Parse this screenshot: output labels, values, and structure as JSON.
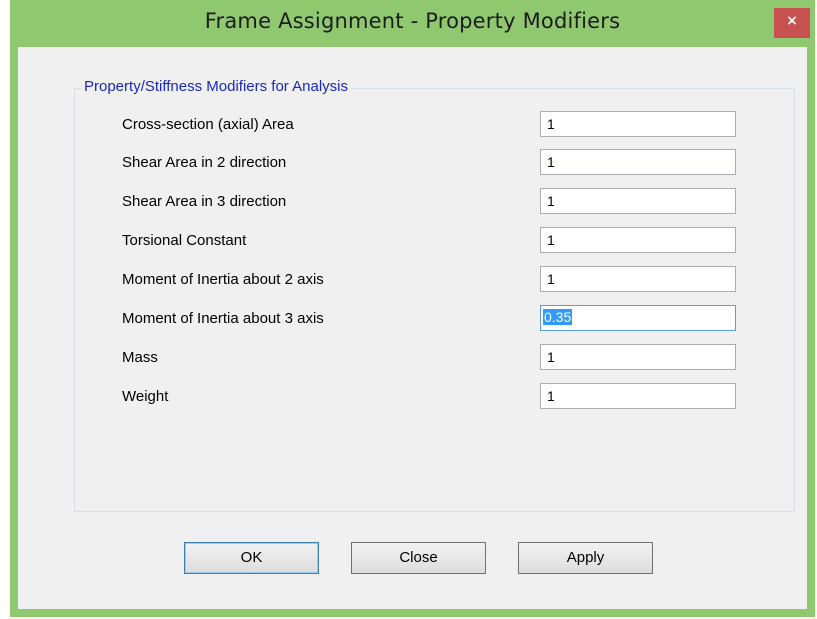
{
  "window": {
    "title": "Frame Assignment - Property Modifiers",
    "close_label": "×"
  },
  "group": {
    "legend": "Property/Stiffness Modifiers for Analysis"
  },
  "rows": [
    {
      "label": "Cross-section (axial) Area",
      "value": "1"
    },
    {
      "label": "Shear Area in 2 direction",
      "value": "1"
    },
    {
      "label": "Shear Area in 3 direction",
      "value": "1"
    },
    {
      "label": "Torsional Constant",
      "value": "1"
    },
    {
      "label": "Moment of Inertia about 2 axis",
      "value": "1"
    },
    {
      "label": "Moment of Inertia about 3 axis",
      "value": "0.35"
    },
    {
      "label": "Mass",
      "value": "1"
    },
    {
      "label": "Weight",
      "value": "1"
    }
  ],
  "buttons": {
    "ok": "OK",
    "close": "Close",
    "apply": "Apply"
  },
  "colors": {
    "window_frame": "#90c870",
    "close_button": "#c75050",
    "group_legend": "#1a27c8",
    "selection": "#3399ff"
  },
  "icons": {
    "close": "close-icon"
  }
}
